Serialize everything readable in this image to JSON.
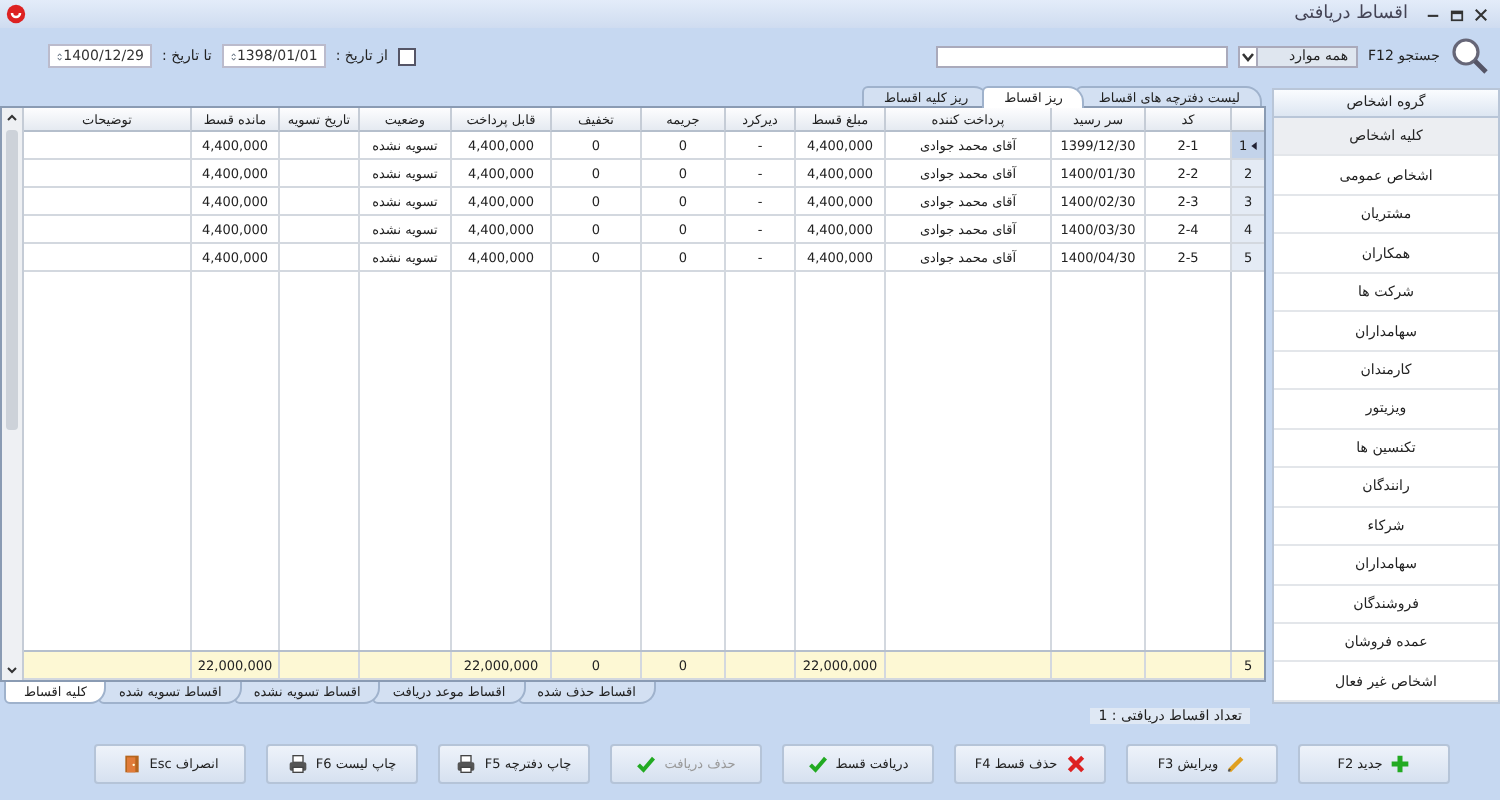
{
  "window": {
    "title": "اقساط دریافتی"
  },
  "toolbar": {
    "search_label": "جستجو F12",
    "filter": "همه موارد",
    "date_filter": {
      "checked": false,
      "from_label": "از تاریخ :",
      "from": "1398/01/01",
      "to_label": "تا تاریخ :",
      "to": "1400/12/29"
    }
  },
  "tabs": [
    {
      "label": "لیست دفترچه های اقساط",
      "selected": false
    },
    {
      "label": "ریز اقساط",
      "selected": true
    },
    {
      "label": "ریز کلیه اقساط",
      "selected": false
    }
  ],
  "table": {
    "columns": [
      "کد",
      "سر رسید",
      "پرداخت کننده",
      "مبلغ قسط",
      "دیرکرد",
      "جریمه",
      "تخفیف",
      "قابل پرداخت",
      "وضعیت",
      "تاریخ تسویه",
      "مانده قسط",
      "توضیحات"
    ],
    "rows": [
      {
        "number": "1",
        "selected": true,
        "cells": [
          "2-1",
          "1399/12/30",
          "آقای محمد جوادی",
          "4,400,000",
          "-",
          "0",
          "0",
          "4,400,000",
          "تسویه نشده",
          null,
          "4,400,000",
          null
        ]
      },
      {
        "number": "2",
        "selected": false,
        "cells": [
          "2-2",
          "1400/01/30",
          "آقای محمد جوادی",
          "4,400,000",
          "-",
          "0",
          "0",
          "4,400,000",
          "تسویه نشده",
          null,
          "4,400,000",
          null
        ]
      },
      {
        "number": "3",
        "selected": false,
        "cells": [
          "2-3",
          "1400/02/30",
          "آقای محمد جوادی",
          "4,400,000",
          "-",
          "0",
          "0",
          "4,400,000",
          "تسویه نشده",
          null,
          "4,400,000",
          null
        ]
      },
      {
        "number": "4",
        "selected": false,
        "cells": [
          "2-4",
          "1400/03/30",
          "آقای محمد جوادی",
          "4,400,000",
          "-",
          "0",
          "0",
          "4,400,000",
          "تسویه نشده",
          null,
          "4,400,000",
          null
        ]
      },
      {
        "number": "5",
        "selected": false,
        "cells": [
          "2-5",
          "1400/04/30",
          "آقای محمد جوادی",
          "4,400,000",
          "-",
          "0",
          "0",
          "4,400,000",
          "تسویه نشده",
          null,
          "4,400,000",
          null
        ]
      }
    ],
    "totals": {
      "count": "5",
      "cells": [
        null,
        null,
        null,
        "22,000,000",
        null,
        "0",
        "0",
        "22,000,000",
        null,
        null,
        "22,000,000",
        null
      ]
    }
  },
  "bottom_tabs": [
    {
      "label": "اقساط حذف شده",
      "selected": false
    },
    {
      "label": "اقساط موعد دریافت",
      "selected": false
    },
    {
      "label": "اقساط تسویه نشده",
      "selected": false
    },
    {
      "label": "اقساط تسویه شده",
      "selected": false
    },
    {
      "label": "کلیه اقساط",
      "selected": true
    }
  ],
  "sidebar": {
    "title": "گروه اشخاص",
    "items": [
      {
        "label": "کلیه اشخاص",
        "selected": true
      },
      {
        "label": "اشخاص عمومی",
        "selected": false
      },
      {
        "label": "مشتریان",
        "selected": false
      },
      {
        "label": "همکاران",
        "selected": false
      },
      {
        "label": "شرکت ها",
        "selected": false
      },
      {
        "label": "سهامداران",
        "selected": false
      },
      {
        "label": "کارمندان",
        "selected": false
      },
      {
        "label": "ویزیتور",
        "selected": false
      },
      {
        "label": "تکنسین ها",
        "selected": false
      },
      {
        "label": "رانندگان",
        "selected": false
      },
      {
        "label": "شرکاء",
        "selected": false
      },
      {
        "label": "سهامداران",
        "selected": false
      },
      {
        "label": "فروشندگان",
        "selected": false
      },
      {
        "label": "عمده فروشان",
        "selected": false
      },
      {
        "label": "اشخاص غیر فعال",
        "selected": false
      }
    ]
  },
  "status_bar": "تعداد اقساط دریافتی : 1",
  "buttons": [
    {
      "label": "جدید F2",
      "kind": "add",
      "disabled": false
    },
    {
      "label": "ویرایش F3",
      "kind": "edit",
      "disabled": false
    },
    {
      "label": "حذف قسط F4",
      "kind": "delete",
      "disabled": false
    },
    {
      "label": "دریافت قسط",
      "kind": "receive",
      "disabled": false
    },
    {
      "label": "حذف دریافت",
      "kind": "receive",
      "disabled": true
    },
    {
      "label": "چاپ دفترچه F5",
      "kind": "print",
      "disabled": false
    },
    {
      "label": "چاپ لیست F6",
      "kind": "print",
      "disabled": false
    },
    {
      "label": "انصراف Esc",
      "kind": "cancel",
      "disabled": false
    }
  ]
}
